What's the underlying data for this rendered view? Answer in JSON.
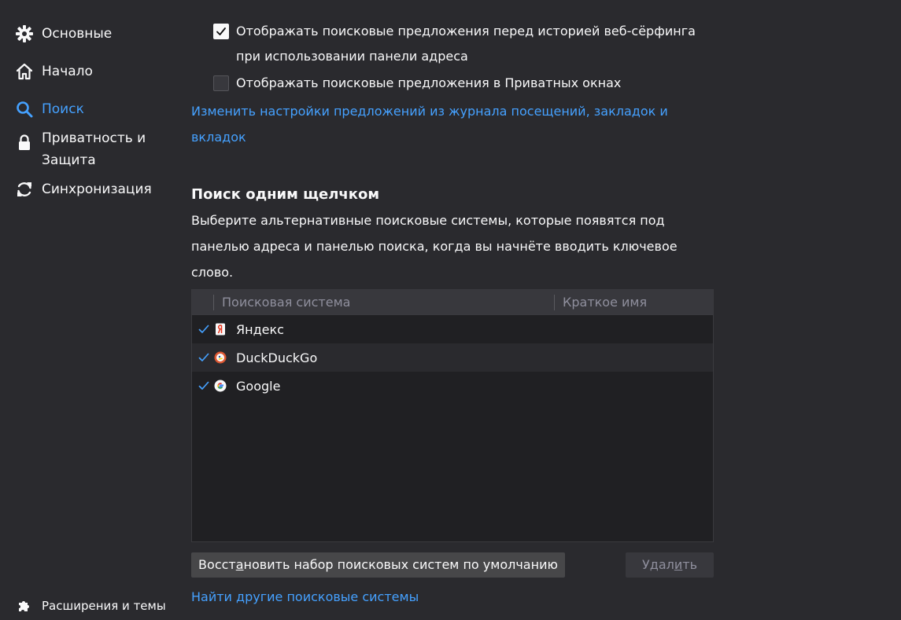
{
  "sidebar": {
    "items": [
      {
        "label": "Основные",
        "icon": "gear-icon"
      },
      {
        "label": "Начало",
        "icon": "home-icon"
      },
      {
        "label": "Поиск",
        "icon": "search-icon"
      },
      {
        "label": "Приватность и",
        "label2": "Защита",
        "icon": "lock-icon"
      },
      {
        "label": "Синхронизация",
        "icon": "sync-icon"
      }
    ],
    "extensions_label": "Расширения и темы",
    "active_color": "#45a1ff"
  },
  "suggestions": {
    "before_history": "Отображать поисковые предложения перед историей веб-сёрфинга",
    "before_history_line2": "при использовании панели адреса",
    "before_history_checked": true,
    "private_windows": "Отображать поисковые предложения в Приватных окнах",
    "private_windows_checked": false,
    "change_link": "Изменить настройки предложений из журнала посещений, закладок и вкладок"
  },
  "one_click": {
    "title": "Поиск одним щелчком",
    "description": "Выберите альтернативные поисковые системы, которые появятся под панелью адреса и панелью поиска, когда вы начнёте вводить ключевое слово.",
    "columns": {
      "engine": "Поисковая система",
      "keyword": "Краткое имя"
    },
    "engines": [
      {
        "name": "Яндекс",
        "checked": true,
        "icon": "yandex-icon"
      },
      {
        "name": "DuckDuckGo",
        "checked": true,
        "icon": "duckduckgo-icon"
      },
      {
        "name": "Google",
        "checked": true,
        "icon": "google-icon"
      }
    ],
    "restore_pre": "Восст",
    "restore_accel": "а",
    "restore_post": "новить набор поисковых систем по умолчанию",
    "remove_pre": "Удал",
    "remove_accel": "и",
    "remove_post": "ть",
    "find_more": "Найти другие поисковые системы"
  }
}
